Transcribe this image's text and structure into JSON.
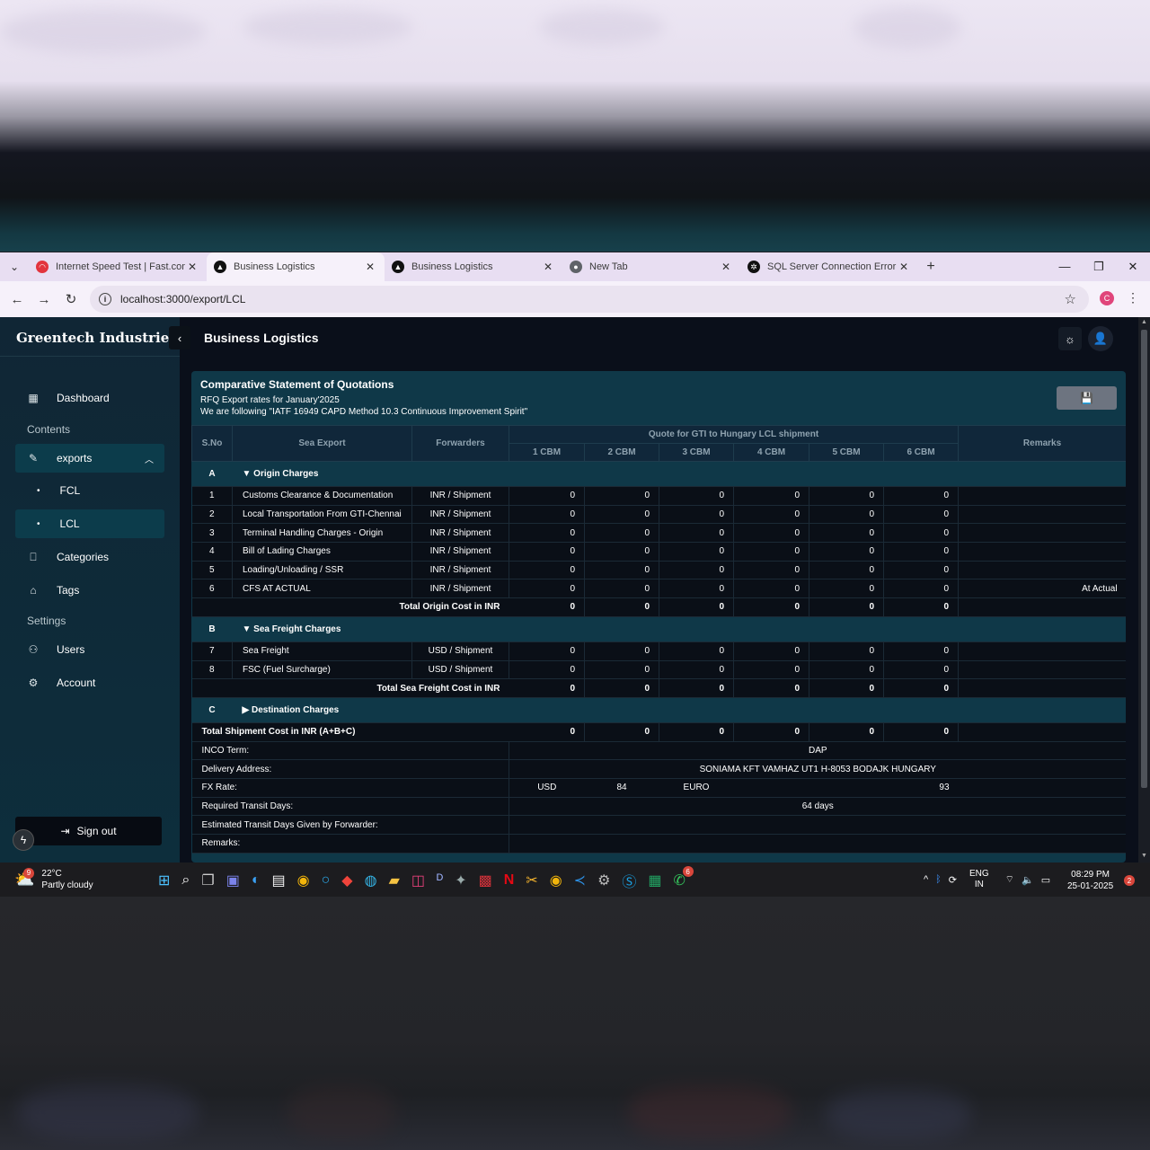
{
  "browser": {
    "tabs": [
      {
        "title": "Internet Speed Test | Fast.com",
        "favicon": "fast-icon",
        "color": "#e2343d"
      },
      {
        "title": "Business Logistics",
        "favicon": "triangle-icon",
        "color": "#111111"
      },
      {
        "title": "Business Logistics",
        "favicon": "triangle-icon",
        "color": "#111111"
      },
      {
        "title": "New Tab",
        "favicon": "chrome-icon",
        "color": "#5f6368"
      },
      {
        "title": "SQL Server Connection Error",
        "favicon": "openai-icon",
        "color": "#111111"
      }
    ],
    "url": "localhost:3000/export/LCL",
    "profile_initial": "C"
  },
  "app": {
    "brand": "Greentech Industries",
    "page_title": "Business Logistics",
    "nav": {
      "dashboard": "Dashboard",
      "contents_heading": "Contents",
      "exports": "exports",
      "fcl": "FCL",
      "lcl": "LCL",
      "categories": "Categories",
      "tags": "Tags",
      "settings_heading": "Settings",
      "users": "Users",
      "account": "Account",
      "signout": "Sign out"
    }
  },
  "card": {
    "title": "Comparative Statement of Quotations",
    "subtitle1": "RFQ Export rates for January'2025",
    "subtitle2": "We are following \"IATF 16949 CAPD Method 10.3 Continuous Improvement Spirit\""
  },
  "table": {
    "headers": {
      "sno": "S.No",
      "sea_export": "Sea Export",
      "forwarders": "Forwarders",
      "quote_group": "Quote for GTI to Hungary LCL shipment",
      "cbm": [
        "1 CBM",
        "2 CBM",
        "3 CBM",
        "4 CBM",
        "5 CBM",
        "6 CBM"
      ],
      "remarks": "Remarks"
    },
    "sections": {
      "A": {
        "letter": "A",
        "title": "▼ Origin Charges"
      },
      "B": {
        "letter": "B",
        "title": "▼ Sea Freight Charges"
      },
      "C": {
        "letter": "C",
        "title": "▶ Destination Charges"
      }
    },
    "origin_rows": [
      {
        "sno": "1",
        "item": "Customs Clearance & Documentation",
        "unit": "INR / Shipment",
        "values": [
          "0",
          "0",
          "0",
          "0",
          "0",
          "0"
        ],
        "remark": ""
      },
      {
        "sno": "2",
        "item": "Local Transportation From GTI-Chennai",
        "unit": "INR / Shipment",
        "values": [
          "0",
          "0",
          "0",
          "0",
          "0",
          "0"
        ],
        "remark": ""
      },
      {
        "sno": "3",
        "item": "Terminal Handling Charges - Origin",
        "unit": "INR / Shipment",
        "values": [
          "0",
          "0",
          "0",
          "0",
          "0",
          "0"
        ],
        "remark": ""
      },
      {
        "sno": "4",
        "item": "Bill of Lading Charges",
        "unit": "INR / Shipment",
        "values": [
          "0",
          "0",
          "0",
          "0",
          "0",
          "0"
        ],
        "remark": ""
      },
      {
        "sno": "5",
        "item": "Loading/Unloading / SSR",
        "unit": "INR / Shipment",
        "values": [
          "0",
          "0",
          "0",
          "0",
          "0",
          "0"
        ],
        "remark": ""
      },
      {
        "sno": "6",
        "item": "CFS AT ACTUAL",
        "unit": "INR / Shipment",
        "values": [
          "0",
          "0",
          "0",
          "0",
          "0",
          "0"
        ],
        "remark": "At Actual"
      }
    ],
    "origin_total": {
      "label": "Total Origin Cost in INR",
      "values": [
        "0",
        "0",
        "0",
        "0",
        "0",
        "0"
      ]
    },
    "sea_rows": [
      {
        "sno": "7",
        "item": "Sea Freight",
        "unit": "USD / Shipment",
        "values": [
          "0",
          "0",
          "0",
          "0",
          "0",
          "0"
        ],
        "remark": ""
      },
      {
        "sno": "8",
        "item": "FSC (Fuel Surcharge)",
        "unit": "USD / Shipment",
        "values": [
          "0",
          "0",
          "0",
          "0",
          "0",
          "0"
        ],
        "remark": ""
      }
    ],
    "sea_total": {
      "label": "Total Sea Freight Cost in INR",
      "values": [
        "0",
        "0",
        "0",
        "0",
        "0",
        "0"
      ]
    },
    "shipment_total": {
      "label": "Total Shipment Cost in INR (A+B+C)",
      "values": [
        "0",
        "0",
        "0",
        "0",
        "0",
        "0"
      ]
    },
    "inco": {
      "label": "INCO Term:",
      "value": "DAP"
    },
    "delivery": {
      "label": "Delivery Address:",
      "value": "SONIAMA KFT VAMHAZ UT1 H-8053 BODAJK HUNGARY"
    },
    "fx": {
      "label": "FX Rate:",
      "cur1": "USD",
      "rate1": "84",
      "cur2": "EURO",
      "rate2": "93"
    },
    "transit": {
      "label": "Required Transit Days:",
      "value": "64 days"
    },
    "est_transit": {
      "label": "Estimated Transit Days Given by Forwarder:",
      "value": ""
    },
    "remarks": {
      "label": "Remarks:",
      "value": ""
    }
  },
  "taskbar": {
    "weather_temp": "22°C",
    "weather_desc": "Partly cloudy",
    "weather_badge": "9",
    "lang1": "ENG",
    "lang2": "IN",
    "time": "08:29 PM",
    "date": "25-01-2025",
    "notif": "2",
    "whatsapp_badge": "6"
  }
}
